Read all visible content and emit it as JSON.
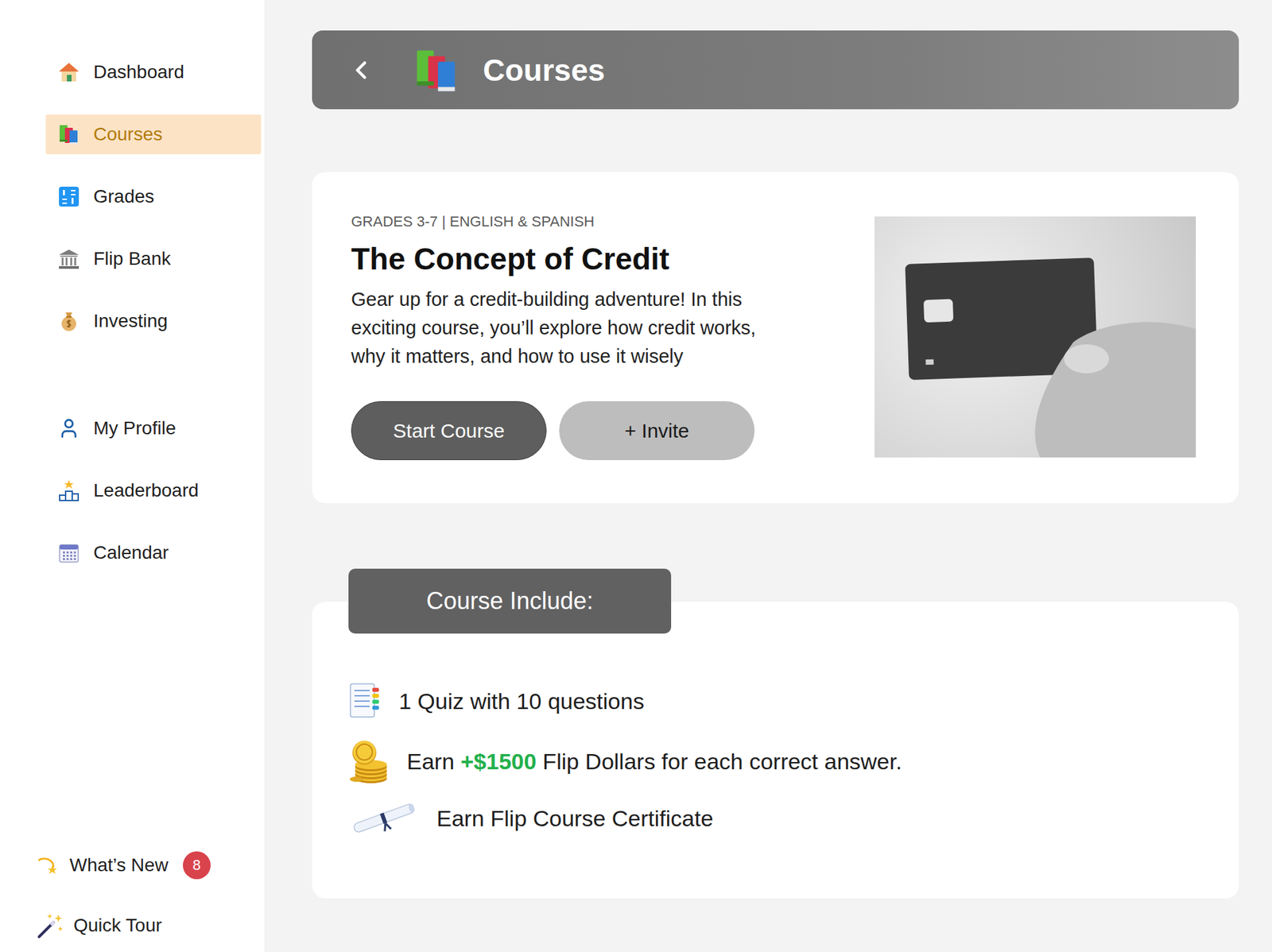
{
  "sidebar": {
    "sections": [
      {
        "items": [
          {
            "label": "Dashboard",
            "selected": false
          },
          {
            "label": "Courses",
            "selected": true
          },
          {
            "label": "Grades",
            "selected": false
          },
          {
            "label": "Flip Bank",
            "selected": false
          },
          {
            "label": "Investing",
            "selected": false
          }
        ]
      },
      {
        "items": [
          {
            "label": "My Profile",
            "selected": false
          },
          {
            "label": "Leaderboard",
            "selected": false
          },
          {
            "label": "Calendar",
            "selected": false
          }
        ]
      }
    ],
    "footer": [
      {
        "label": "What’s New",
        "badge": "8"
      },
      {
        "label": "Quick Tour"
      }
    ]
  },
  "header": {
    "title": "Courses"
  },
  "course": {
    "meta": "GRADES 3-7 | ENGLISH & SPANISH",
    "title": "The Concept of Credit",
    "description": "Gear up for a credit-building adventure! In this exciting course, you’ll explore how credit works, why it matters, and how to use it wisely",
    "buttons": [
      {
        "label": "Start Course",
        "kind": "primary"
      },
      {
        "label": "+ Invite",
        "kind": "secondary"
      }
    ]
  },
  "include": {
    "heading": "Course Include:",
    "items": [
      {
        "parts": [
          {
            "text": "1 Quiz with 10 questions",
            "highlight": false
          }
        ]
      },
      {
        "parts": [
          {
            "text": "Earn ",
            "highlight": false
          },
          {
            "text": "+$1500",
            "highlight": true
          },
          {
            "text": " Flip Dollars for each correct answer.",
            "highlight": false
          }
        ]
      },
      {
        "parts": [
          {
            "text": "Earn Flip Course Certificate",
            "highlight": false
          }
        ]
      }
    ]
  }
}
